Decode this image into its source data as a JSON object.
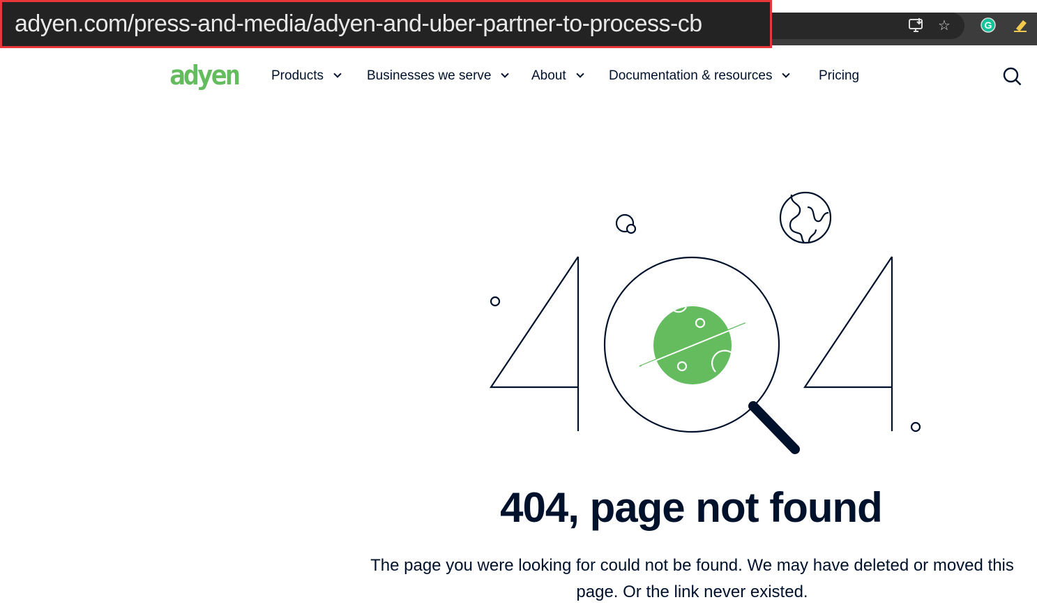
{
  "browser": {
    "url": "adyen.com/press-and-media/adyen-and-uber-partner-to-process-cb",
    "icons": [
      "install-app-icon",
      "bookmark-star-icon",
      "grammarly-icon",
      "highlighter-extension-icon"
    ]
  },
  "nav": {
    "logo": "adyen",
    "items": [
      {
        "label": "Products"
      },
      {
        "label": "Businesses we serve"
      },
      {
        "label": "About"
      },
      {
        "label": "Documentation & resources"
      },
      {
        "label": "Pricing"
      }
    ]
  },
  "colors": {
    "brand": "#64bc5f",
    "text": "#00112c"
  },
  "main": {
    "title": "404, page not found",
    "description": "The page you were looking for could not be found. We may have deleted or moved this page. Or the link never existed."
  }
}
